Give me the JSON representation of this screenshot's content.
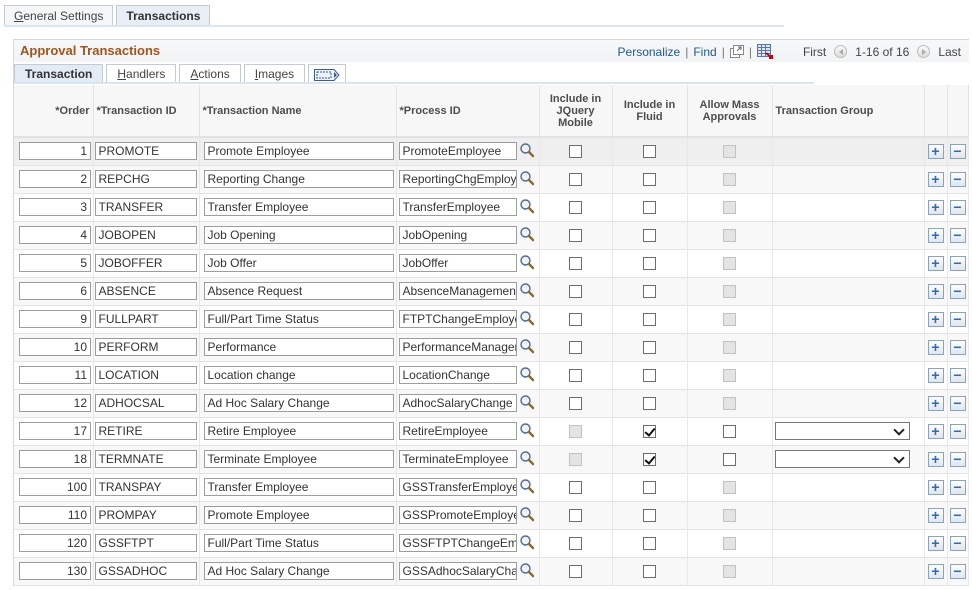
{
  "page_tabs": [
    {
      "label": "General Settings",
      "active": false
    },
    {
      "label": "Transactions",
      "active": true
    }
  ],
  "grid": {
    "title": "Approval Transactions",
    "toolbar": {
      "personalize": "Personalize",
      "find": "Find",
      "separator": "|",
      "first": "First",
      "range": "1-16 of 16",
      "last": "Last"
    },
    "tabs": [
      {
        "label": "Transaction",
        "active": true
      },
      {
        "label": "Handlers",
        "active": false
      },
      {
        "label": "Actions",
        "active": false
      },
      {
        "label": "Images",
        "active": false
      }
    ],
    "columns": {
      "order": "*Order",
      "transaction_id": "*Transaction ID",
      "transaction_name": "*Transaction Name",
      "process_id": "*Process ID",
      "jquery_mobile": "Include in JQuery Mobile",
      "fluid": "Include in Fluid",
      "mass_approvals": "Allow Mass Approvals",
      "transaction_group": "Transaction Group"
    },
    "rows": [
      {
        "order": "1",
        "id": "PROMOTE",
        "name": "Promote Employee",
        "process": "PromoteEmployee",
        "jquery": false,
        "jquery_disabled": false,
        "fluid": false,
        "mass": false,
        "mass_disabled": true,
        "group_select": false,
        "group": ""
      },
      {
        "order": "2",
        "id": "REPCHG",
        "name": "Reporting Change",
        "process": "ReportingChgEmployee",
        "jquery": false,
        "jquery_disabled": false,
        "fluid": false,
        "mass": false,
        "mass_disabled": true,
        "group_select": false,
        "group": ""
      },
      {
        "order": "3",
        "id": "TRANSFER",
        "name": "Transfer Employee",
        "process": "TransferEmployee",
        "jquery": false,
        "jquery_disabled": false,
        "fluid": false,
        "mass": false,
        "mass_disabled": true,
        "group_select": false,
        "group": ""
      },
      {
        "order": "4",
        "id": "JOBOPEN",
        "name": "Job Opening",
        "process": "JobOpening",
        "jquery": false,
        "jquery_disabled": false,
        "fluid": false,
        "mass": false,
        "mass_disabled": true,
        "group_select": false,
        "group": ""
      },
      {
        "order": "5",
        "id": "JOBOFFER",
        "name": "Job Offer",
        "process": "JobOffer",
        "jquery": false,
        "jquery_disabled": false,
        "fluid": false,
        "mass": false,
        "mass_disabled": true,
        "group_select": false,
        "group": ""
      },
      {
        "order": "6",
        "id": "ABSENCE",
        "name": "Absence Request",
        "process": "AbsenceManagement",
        "jquery": false,
        "jquery_disabled": false,
        "fluid": false,
        "mass": false,
        "mass_disabled": true,
        "group_select": false,
        "group": ""
      },
      {
        "order": "9",
        "id": "FULLPART",
        "name": "Full/Part Time Status",
        "process": "FTPTChangeEmployee",
        "jquery": false,
        "jquery_disabled": false,
        "fluid": false,
        "mass": false,
        "mass_disabled": true,
        "group_select": false,
        "group": ""
      },
      {
        "order": "10",
        "id": "PERFORM",
        "name": "Performance",
        "process": "PerformanceManager",
        "jquery": false,
        "jquery_disabled": false,
        "fluid": false,
        "mass": false,
        "mass_disabled": true,
        "group_select": false,
        "group": ""
      },
      {
        "order": "11",
        "id": "LOCATION",
        "name": "Location change",
        "process": "LocationChange",
        "jquery": false,
        "jquery_disabled": false,
        "fluid": false,
        "mass": false,
        "mass_disabled": true,
        "group_select": false,
        "group": ""
      },
      {
        "order": "12",
        "id": "ADHOCSAL",
        "name": "Ad Hoc Salary Change",
        "process": "AdhocSalaryChange",
        "jquery": false,
        "jquery_disabled": false,
        "fluid": false,
        "mass": false,
        "mass_disabled": true,
        "group_select": false,
        "group": ""
      },
      {
        "order": "17",
        "id": "RETIRE",
        "name": "Retire Employee",
        "process": "RetireEmployee",
        "jquery": false,
        "jquery_disabled": true,
        "fluid": true,
        "mass": false,
        "mass_disabled": false,
        "group_select": true,
        "group": ""
      },
      {
        "order": "18",
        "id": "TERMNATE",
        "name": "Terminate Employee",
        "process": "TerminateEmployee",
        "jquery": false,
        "jquery_disabled": true,
        "fluid": true,
        "mass": false,
        "mass_disabled": false,
        "group_select": true,
        "group": ""
      },
      {
        "order": "100",
        "id": "TRANSPAY",
        "name": "Transfer Employee",
        "process": "GSSTransferEmployee",
        "jquery": false,
        "jquery_disabled": false,
        "fluid": false,
        "mass": false,
        "mass_disabled": true,
        "group_select": false,
        "group": ""
      },
      {
        "order": "110",
        "id": "PROMPAY",
        "name": "Promote Employee",
        "process": "GSSPromoteEmployee",
        "jquery": false,
        "jquery_disabled": false,
        "fluid": false,
        "mass": false,
        "mass_disabled": true,
        "group_select": false,
        "group": ""
      },
      {
        "order": "120",
        "id": "GSSFTPT",
        "name": "Full/Part Time Status",
        "process": "GSSFTPTChangeEmployee",
        "jquery": false,
        "jquery_disabled": false,
        "fluid": false,
        "mass": false,
        "mass_disabled": true,
        "group_select": false,
        "group": ""
      },
      {
        "order": "130",
        "id": "GSSADHOC",
        "name": "Ad Hoc Salary Change",
        "process": "GSSAdhocSalaryChange",
        "jquery": false,
        "jquery_disabled": false,
        "fluid": false,
        "mass": false,
        "mass_disabled": true,
        "group_select": false,
        "group": ""
      }
    ],
    "row_actions": {
      "add": "+",
      "delete": "−"
    }
  },
  "colors": {
    "title": "#a1551c",
    "link": "#1f5a92",
    "row_button": "#2f6bb0"
  }
}
